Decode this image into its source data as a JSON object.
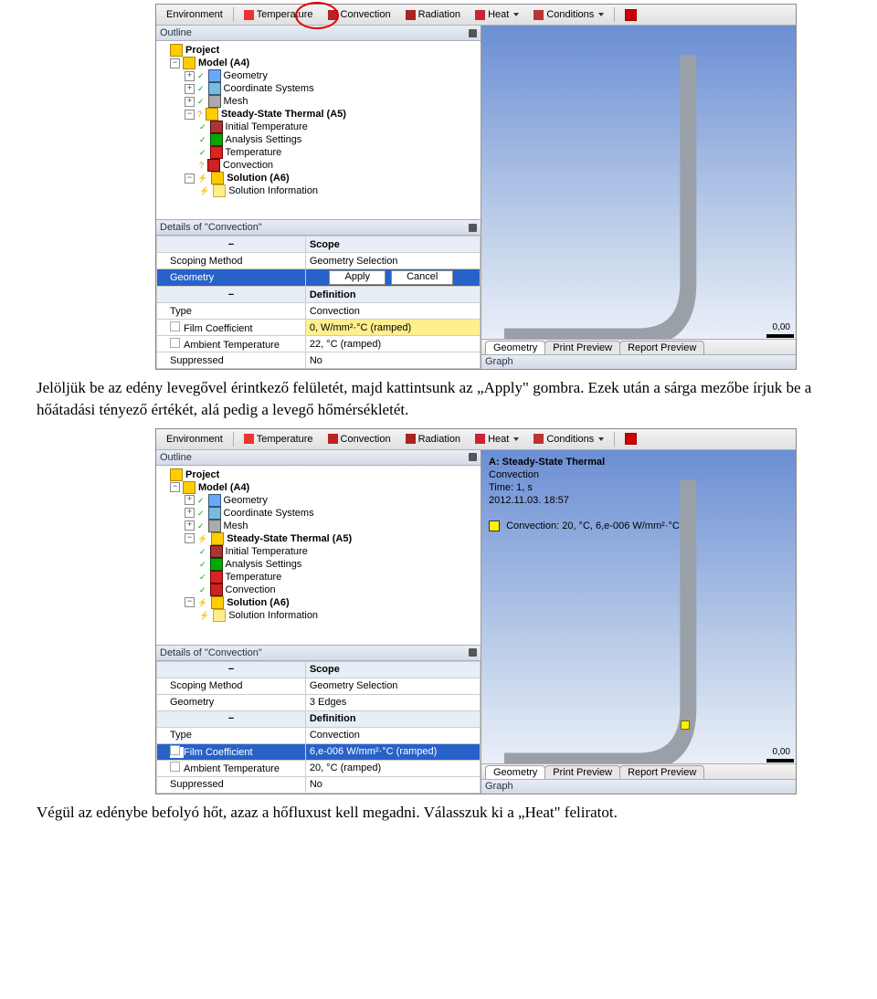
{
  "toolbar": {
    "environment": "Environment",
    "temperature": "Temperature",
    "convection": "Convection",
    "radiation": "Radiation",
    "heat": "Heat",
    "conditions": "Conditions"
  },
  "outline": {
    "title": "Outline",
    "project": "Project",
    "model": "Model (A4)",
    "geometry": "Geometry",
    "coord": "Coordinate Systems",
    "mesh": "Mesh",
    "sst": "Steady-State Thermal (A5)",
    "inittemp": "Initial Temperature",
    "analysis": "Analysis Settings",
    "temperature": "Temperature",
    "convection": "Convection",
    "solution": "Solution (A6)",
    "solinfo": "Solution Information"
  },
  "details1": {
    "title": "Details of \"Convection\"",
    "scope": "Scope",
    "scoping_k": "Scoping Method",
    "scoping_v": "Geometry Selection",
    "geometry_k": "Geometry",
    "apply": "Apply",
    "cancel": "Cancel",
    "definition": "Definition",
    "type_k": "Type",
    "type_v": "Convection",
    "film_k": "Film Coefficient",
    "film_v": "0, W/mm²·°C (ramped)",
    "amb_k": "Ambient Temperature",
    "amb_v": "22, °C (ramped)",
    "sup_k": "Suppressed",
    "sup_v": "No"
  },
  "details2": {
    "title": "Details of \"Convection\"",
    "scope": "Scope",
    "scoping_k": "Scoping Method",
    "scoping_v": "Geometry Selection",
    "geometry_k": "Geometry",
    "geometry_v": "3 Edges",
    "definition": "Definition",
    "type_k": "Type",
    "type_v": "Convection",
    "film_k": "Film Coefficient",
    "film_v": "6,e-006 W/mm²·°C (ramped)",
    "amb_k": "Ambient Temperature",
    "amb_v": "20, °C (ramped)",
    "sup_k": "Suppressed",
    "sup_v": "No"
  },
  "canvas": {
    "zero": "0,00",
    "tabs": {
      "geo": "Geometry",
      "print": "Print Preview",
      "report": "Report Preview"
    },
    "graph": "Graph"
  },
  "overlay2": {
    "hdr1": "A: Steady-State Thermal",
    "hdr2": "Convection",
    "time": "Time: 1, s",
    "stamp": "2012.11.03. 18:57",
    "legend": "Convection: 20, °C, 6,e-006 W/mm²·°C"
  },
  "doc": {
    "p1": "Jelöljük be az edény levegővel érintkező felületét, majd kattintsunk az „Apply\" gombra. Ezek után a sárga mezőbe írjuk be a hőátadási tényező értékét, alá pedig a levegő hőmérsékletét.",
    "p2": "Végül az edénybe befolyó hőt, azaz a hőfluxust kell megadni. Válasszuk ki a „Heat\" feliratot."
  }
}
